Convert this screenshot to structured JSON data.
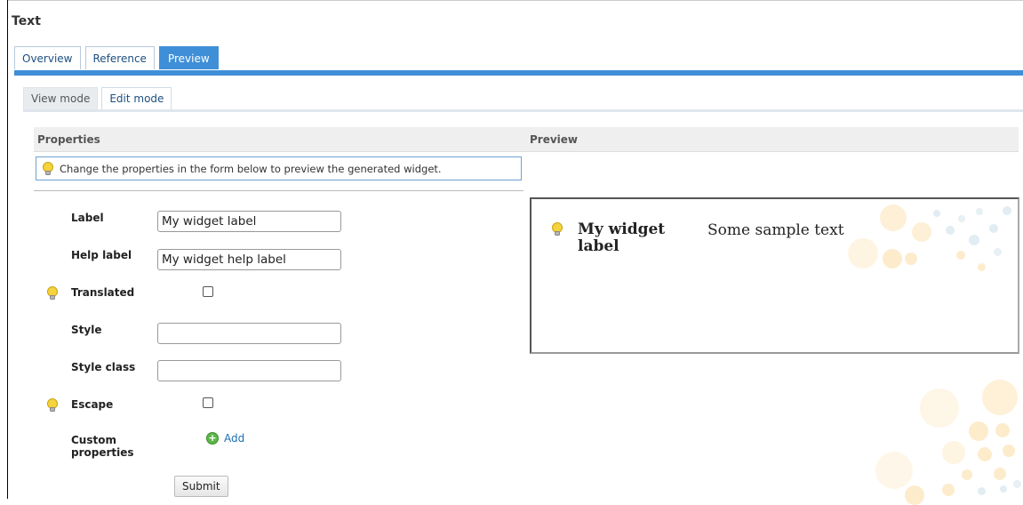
{
  "page": {
    "title": "Text"
  },
  "tabs": [
    {
      "label": "Overview",
      "active": false
    },
    {
      "label": "Reference",
      "active": false
    },
    {
      "label": "Preview",
      "active": true
    }
  ],
  "subtabs": [
    {
      "label": "View mode",
      "active": true
    },
    {
      "label": "Edit mode",
      "active": false
    }
  ],
  "sections": {
    "properties": "Properties",
    "preview": "Preview"
  },
  "info": {
    "text": "Change the properties in the form below to preview the generated widget."
  },
  "form": {
    "label": {
      "label": "Label",
      "value": "My widget label"
    },
    "help_label": {
      "label": "Help label",
      "value": "My widget help label"
    },
    "translated": {
      "label": "Translated",
      "checked": false
    },
    "style": {
      "label": "Style",
      "value": ""
    },
    "style_class": {
      "label": "Style class",
      "value": ""
    },
    "escape": {
      "label": "Escape",
      "checked": false
    },
    "custom_properties": {
      "label": "Custom properties",
      "add_label": "Add"
    },
    "submit_label": "Submit"
  },
  "preview": {
    "widget_label": "My widget label",
    "widget_text": "Some sample text"
  },
  "colors": {
    "accent": "#3f8fd8",
    "tab_text": "#1d4f7f",
    "decor_dots": "#fde9c2"
  },
  "icons": {
    "bulb": "lightbulb-icon",
    "add": "add-circle-icon"
  }
}
